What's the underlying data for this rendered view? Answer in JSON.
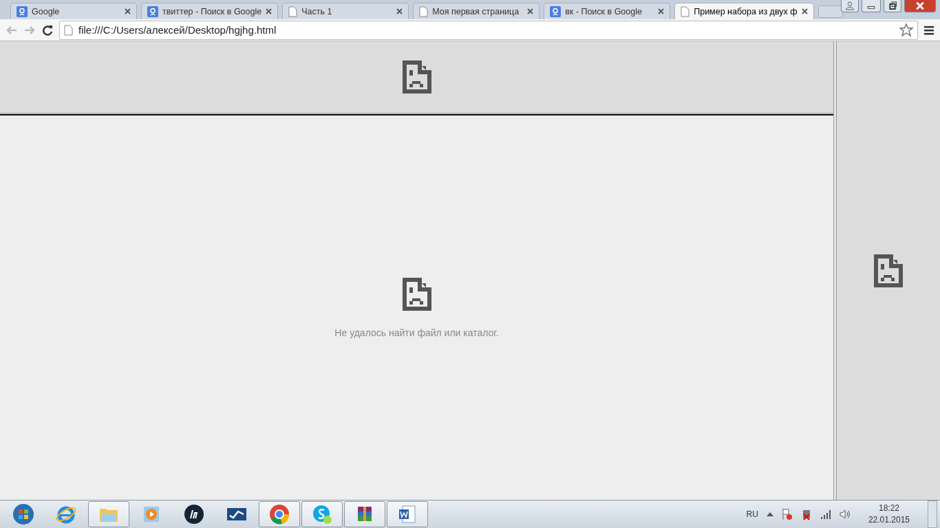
{
  "tabs": [
    {
      "title": "Google",
      "kind": "google",
      "selected": false
    },
    {
      "title": "твиттер - Поиск в Google",
      "kind": "google",
      "selected": false
    },
    {
      "title": "Часть 1",
      "kind": "page",
      "selected": false
    },
    {
      "title": "Моя первая страница",
      "kind": "page",
      "selected": false
    },
    {
      "title": "вк - Поиск в Google",
      "kind": "google",
      "selected": false
    },
    {
      "title": "Пример набора из двух ф",
      "kind": "page",
      "selected": true
    }
  ],
  "address_bar": {
    "value": "file:///C:/Users/алексей/Desktop/hgjhg.html"
  },
  "frames": {
    "main": {
      "message": "Не удалось найти файл или каталог."
    }
  },
  "taskbar": {
    "items": [
      {
        "kind": "start",
        "open": false
      },
      {
        "kind": "ie",
        "open": false
      },
      {
        "kind": "folder",
        "open": true
      },
      {
        "kind": "media",
        "open": false
      },
      {
        "kind": "hp",
        "open": false
      },
      {
        "kind": "wave",
        "open": false
      },
      {
        "kind": "chrome",
        "open": true
      },
      {
        "kind": "skype",
        "open": true
      },
      {
        "kind": "archive",
        "open": true
      },
      {
        "kind": "word",
        "open": true
      }
    ],
    "language": "RU",
    "time": "18:22",
    "date": "22.01.2015"
  }
}
